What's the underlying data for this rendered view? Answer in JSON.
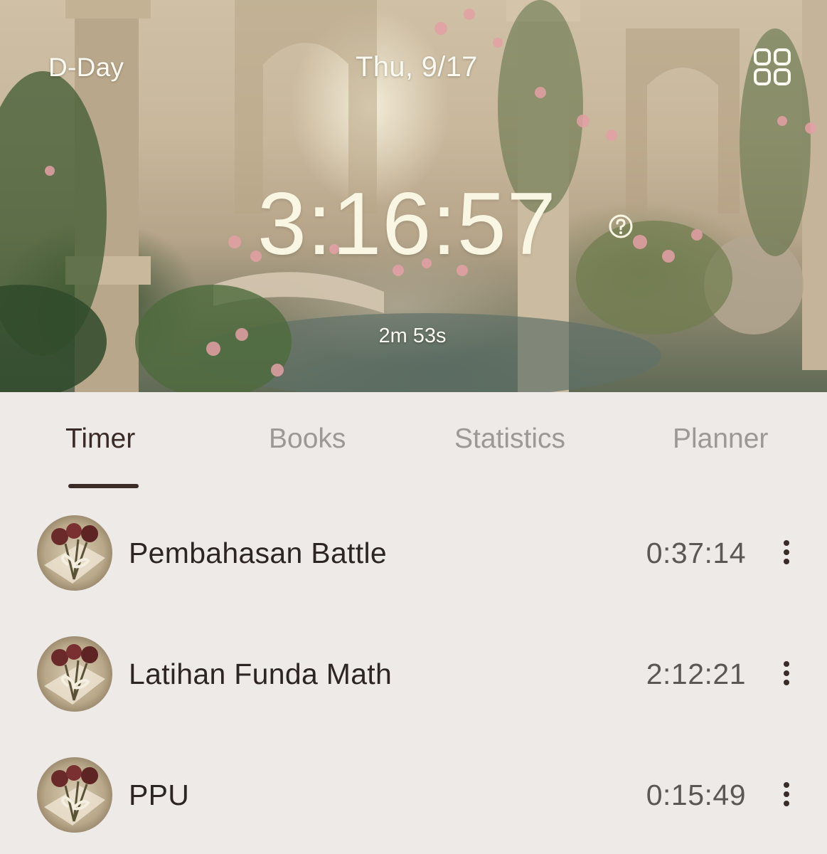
{
  "header": {
    "dday_label": "D-Day",
    "date": "Thu, 9/17",
    "total_time": "3:16:57",
    "session_time": "2m 53s"
  },
  "tabs": [
    {
      "label": "Timer",
      "active": true
    },
    {
      "label": "Books",
      "active": false
    },
    {
      "label": "Statistics",
      "active": false
    },
    {
      "label": "Planner",
      "active": false
    }
  ],
  "subjects": [
    {
      "name": "Pembahasan Battle",
      "time": "0:37:14"
    },
    {
      "name": "Latihan Funda Math",
      "time": "2:12:21"
    },
    {
      "name": "PPU",
      "time": "0:15:49"
    }
  ],
  "icons": {
    "layout": "grid-icon",
    "help": "help-circle-icon",
    "more": "more-vertical-icon"
  },
  "colors": {
    "background": "#eeeae7",
    "header_text": "#fbfaf2",
    "active_tab": "#3b2b27",
    "inactive_tab": "#9b9895",
    "subject_name": "#2d2523",
    "subject_time": "#5b5755"
  }
}
